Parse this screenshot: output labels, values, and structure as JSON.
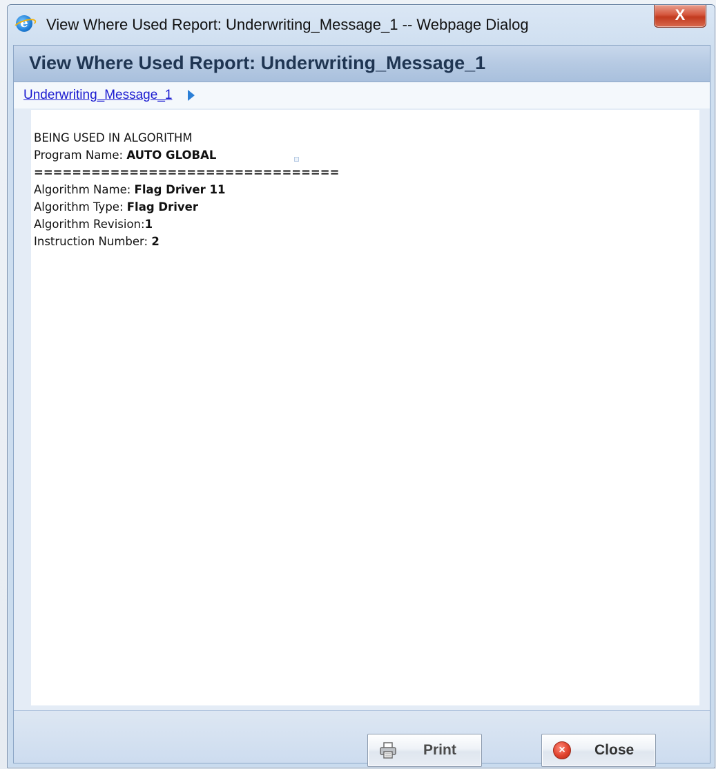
{
  "window": {
    "title": "View Where Used Report: Underwriting_Message_1 -- Webpage Dialog",
    "close_glyph": "X"
  },
  "dialog": {
    "header_title": "View Where Used Report: Underwriting_Message_1",
    "breadcrumb": "Underwriting_Message_1"
  },
  "report": {
    "section_heading": "BEING USED IN ALGORITHM",
    "program_name_label": "Program Name: ",
    "program_name_value": "AUTO GLOBAL",
    "separator": "================================",
    "algorithm_name_label": "Algorithm Name: ",
    "algorithm_name_value": "Flag Driver 11",
    "algorithm_type_label": "Algorithm Type: ",
    "algorithm_type_value": "Flag Driver",
    "algorithm_revision_label": "Algorithm Revision:",
    "algorithm_revision_value": "1",
    "instruction_number_label": "Instruction Number: ",
    "instruction_number_value": "2"
  },
  "footer": {
    "print_label": "Print",
    "close_label": "Close",
    "close_icon_glyph": "×"
  },
  "icons": {
    "window_icon": "internet-explorer-icon",
    "print_icon": "printer-icon",
    "close_icon": "close-circle-icon",
    "breadcrumb_arrow": "triangle-right-icon"
  },
  "colors": {
    "header_title": "#1f3552",
    "link": "#1a1ad0",
    "close_button": "#d5563d"
  }
}
